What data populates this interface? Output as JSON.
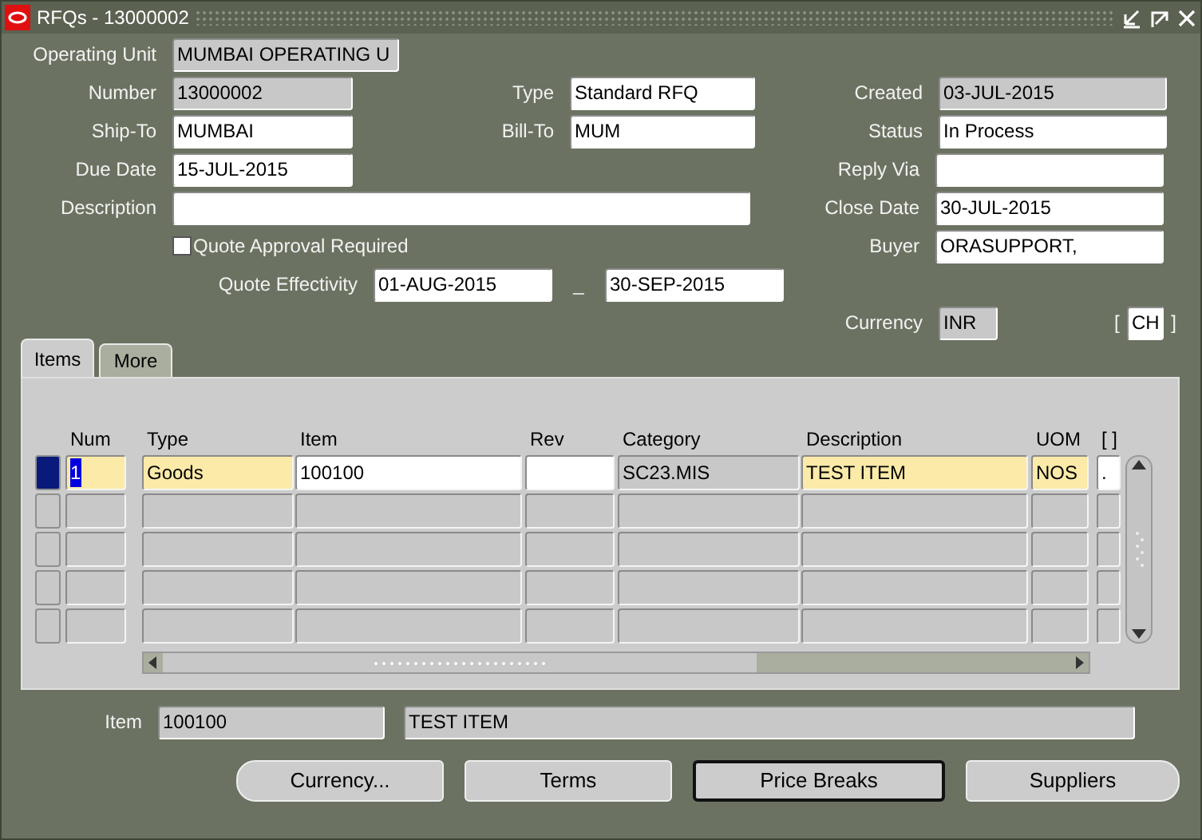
{
  "window": {
    "title": "RFQs - 13000002"
  },
  "header_rows": [
    {
      "left": {
        "label": "Operating Unit",
        "value": "MUMBAI OPERATING U",
        "readonly": true
      }
    },
    {
      "left": {
        "label": "Number",
        "value": "13000002",
        "readonly": true
      },
      "middle": {
        "label": "Type",
        "value": "Standard RFQ",
        "readonly": false
      },
      "right": {
        "label": "Created",
        "value": "03-JUL-2015",
        "readonly": true
      }
    },
    {
      "left": {
        "label": "Ship-To",
        "value": "MUMBAI",
        "readonly": false
      },
      "middle": {
        "label": "Bill-To",
        "value": "MUM",
        "readonly": false
      },
      "right": {
        "label": "Status",
        "value": "In Process",
        "readonly": false
      }
    },
    {
      "left": {
        "label": "Due Date",
        "value": "15-JUL-2015",
        "readonly": false
      },
      "right": {
        "label": "Reply Via",
        "readonly": false
      }
    },
    {
      "left": {
        "label": "Description",
        "readonly": false
      },
      "right": {
        "label": "Close Date",
        "value": "30-JUL-2015",
        "readonly": false
      }
    },
    {
      "checkbox": {
        "label": "Quote Approval Required",
        "checked": false
      },
      "right": {
        "label": "Buyer",
        "value": "ORASUPPORT,",
        "readonly": false
      }
    }
  ],
  "quote_effectivity": {
    "label": "Quote Effectivity",
    "from": "01-AUG-2015",
    "separator": "_",
    "to": "30-SEP-2015"
  },
  "currency": {
    "label": "Currency",
    "value": "INR",
    "readonly": true,
    "open_bracket": "[",
    "flex_value": "CH",
    "close_bracket": "]"
  },
  "tabs": [
    {
      "label": "Items",
      "selected": true
    },
    {
      "label": "More",
      "selected": false
    }
  ],
  "table": {
    "columns": [
      "Num",
      "Type",
      "Item",
      "Rev",
      "Category",
      "Description",
      "UOM",
      "[ ]"
    ],
    "rows": [
      {
        "selected": true,
        "cells": [
          {
            "value": "1",
            "kind": "required",
            "highlighted": true
          },
          {
            "value": "Goods",
            "kind": "required",
            "highlighted": false
          },
          {
            "value": "100100",
            "kind": "editable",
            "highlighted": false
          },
          {
            "kind": "editable"
          },
          {
            "value": "SC23.MIS",
            "kind": "readonly",
            "highlighted": false
          },
          {
            "value": "TEST ITEM",
            "kind": "required",
            "highlighted": false
          },
          {
            "value": "NOS",
            "kind": "required",
            "highlighted": false
          },
          {
            "value": ".",
            "kind": "editable",
            "highlighted": false
          }
        ]
      },
      {
        "selected": false
      },
      {
        "selected": false
      },
      {
        "selected": false
      },
      {
        "selected": false
      }
    ]
  },
  "item_summary": {
    "label": "Item",
    "code": "100100",
    "description": "TEST ITEM"
  },
  "buttons": [
    {
      "label": "Currency...",
      "default": false
    },
    {
      "label": "Terms",
      "default": false
    },
    {
      "label": "Price Breaks",
      "default": true
    },
    {
      "label": "Suppliers",
      "default": false
    }
  ]
}
